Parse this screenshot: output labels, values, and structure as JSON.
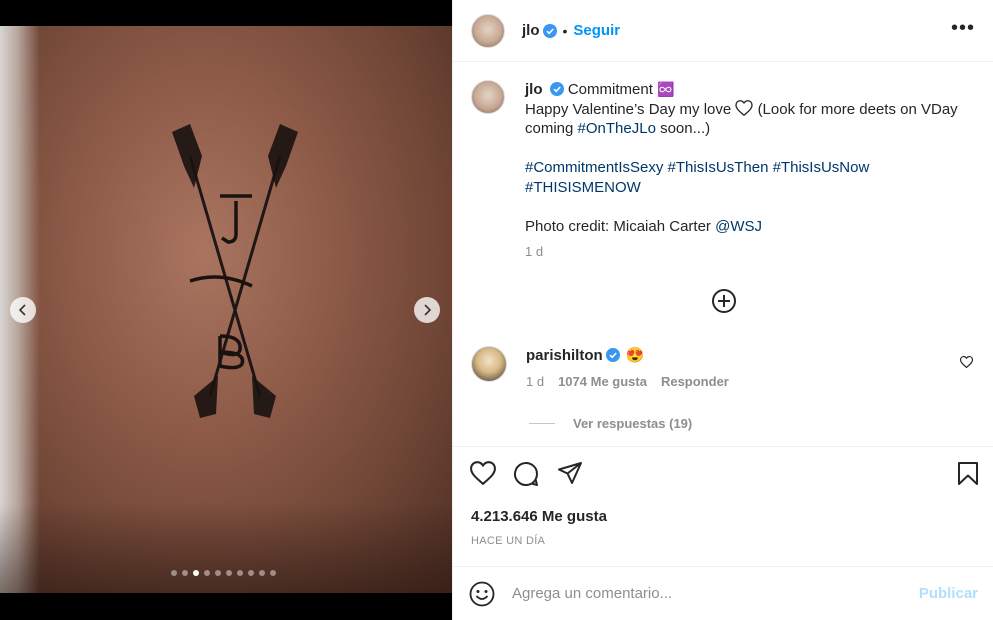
{
  "post": {
    "author": "jlo",
    "follow_label": "Seguir",
    "separator": "•",
    "more_label": "•••"
  },
  "caption": {
    "username": "jlo",
    "title": "Commitment",
    "title_emoji": "♾️",
    "line1_pre": "Happy Valentine’s Day my love",
    "line1_post": "(Look for more deets on VDay coming",
    "hashtag_onthejlo": "#OnTheJLo",
    "line1_end": "soon...)",
    "hashtags": [
      "#CommitmentIsSexy",
      "#ThisIsUsThen",
      "#ThisIsUsNow",
      "#THISISMENOW"
    ],
    "credit_text": "Photo credit: Micaiah Carter",
    "credit_mention": "@WSJ",
    "time": "1 d"
  },
  "comment": {
    "username": "parishilton",
    "emoji": "😍",
    "time": "1 d",
    "likes": "1074 Me gusta",
    "reply": "Responder",
    "view_replies": "Ver respuestas (19)"
  },
  "stats": {
    "likes": "4.213.646 Me gusta",
    "date": "HACE UN DÍA"
  },
  "composer": {
    "placeholder": "Agrega un comentario...",
    "publish": "Publicar"
  },
  "carousel": {
    "total": 10,
    "active_index": 2
  },
  "colors": {
    "link": "#0095f6",
    "hashtag": "#00376b",
    "verified": "#3897f0",
    "publish_disabled": "#b2dffc"
  }
}
